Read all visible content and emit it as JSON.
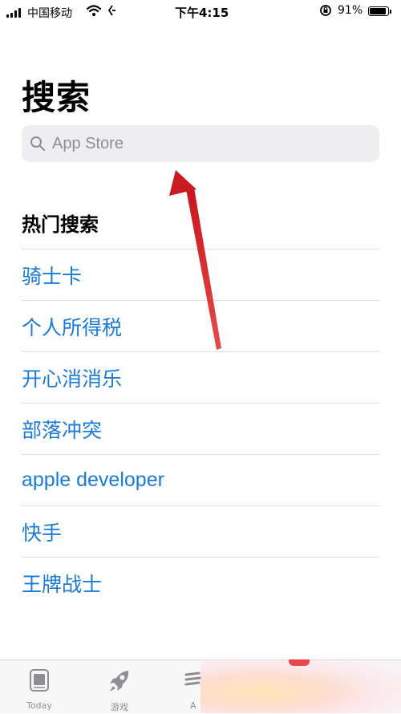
{
  "status_bar": {
    "carrier": "中国移动",
    "time": "下午4:15",
    "battery_percent": "91%",
    "battery_level": 0.91
  },
  "header": {
    "title": "搜索"
  },
  "search": {
    "placeholder": "App Store",
    "value": ""
  },
  "trending": {
    "title": "热门搜索",
    "items": [
      "骑士卡",
      "个人所得税",
      "开心消消乐",
      "部落冲突",
      "apple developer",
      "快手",
      "王牌战士"
    ]
  },
  "tab_bar": {
    "tabs": [
      {
        "label": "Today",
        "icon": "today-icon"
      },
      {
        "label": "游戏",
        "icon": "rocket-icon"
      },
      {
        "label": "A",
        "icon": "apps-stack-icon"
      }
    ]
  },
  "colors": {
    "link": "#1a7ad9",
    "annotation_arrow": "#d9262a",
    "search_bg": "#eeeef0"
  }
}
